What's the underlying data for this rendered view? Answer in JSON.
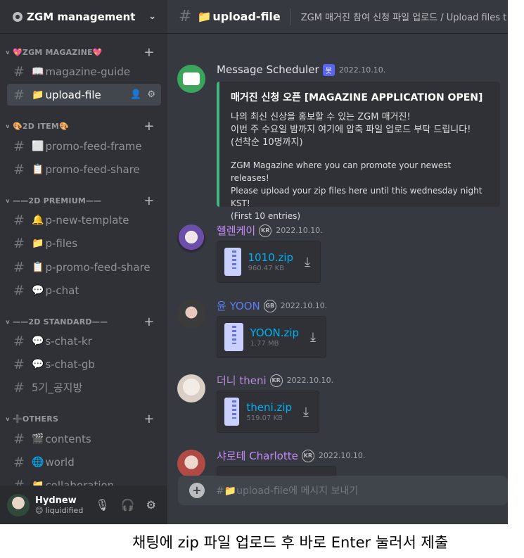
{
  "server": {
    "name": "ZGM management"
  },
  "sidebar": {
    "categories": [
      {
        "label": "💖ZGM MAGAZINE💖"
      },
      {
        "label": "🎨2D ITEM🎨"
      },
      {
        "label": "——2D PREMIUM——"
      },
      {
        "label": "——2D STANDARD——"
      },
      {
        "label": "➕OTHERS"
      }
    ],
    "channels": [
      {
        "emoji": "📖",
        "label": "magazine-guide"
      },
      {
        "emoji": "📁",
        "label": "upload-file"
      },
      {
        "emoji": "⬜",
        "label": "promo-feed-frame"
      },
      {
        "emoji": "📋",
        "label": "promo-feed-share"
      },
      {
        "emoji": "🔔",
        "label": "p-new-template"
      },
      {
        "emoji": "📁",
        "label": "p-files"
      },
      {
        "emoji": "📋",
        "label": "p-promo-feed-share"
      },
      {
        "emoji": "💬",
        "label": "p-chat"
      },
      {
        "emoji": "💬",
        "label": "s-chat-kr"
      },
      {
        "emoji": "💬",
        "label": "s-chat-gb"
      },
      {
        "emoji": "",
        "label": "5기_공지방"
      },
      {
        "emoji": "🎬",
        "label": "contents"
      },
      {
        "emoji": "🌐",
        "label": "world"
      },
      {
        "emoji": "📁",
        "label": "collaboration"
      }
    ]
  },
  "user": {
    "name": "Hydnew",
    "status": "liquidified"
  },
  "topbar": {
    "channel_emoji": "📁",
    "channel": "upload-file",
    "topic": "ZGM 매거진 참여 신청 파일 업로드 / Upload files t"
  },
  "messages": [
    {
      "author": "Message Scheduler",
      "badge": "봇",
      "timestamp": "2022.10.10.",
      "embed": {
        "title": "매거진 신청 오픈 [MAGAZINE APPLICATION OPEN]",
        "ko_lines": [
          "나의 최신 신상을 홍보할 수 있는 ZGM 매거진!",
          "이번 주 수요일 밤까지 여기에 압축 파일 업로드 부탁 드립니다!",
          "(선착순 10명까지)"
        ],
        "en_lines": [
          "ZGM Magazine where you can promote your newest releases!",
          "Please upload your zip files here until this wednesday night KST!",
          "(First 10 entries)"
        ]
      }
    },
    {
      "author": "헬렌케이",
      "flag": "KR",
      "timestamp": "2022.10.10.",
      "file": "1010.zip",
      "size": "960.47 KB"
    },
    {
      "author": "윤 YOON",
      "flag": "GB",
      "timestamp": "2022.10.10.",
      "file": "YOON.zip",
      "size": "1.77 MB"
    },
    {
      "author": "더니 theni",
      "flag": "KR",
      "timestamp": "2022.10.10.",
      "file": "theni.zip",
      "size": "519.07 KB"
    },
    {
      "author": "샤로테 Charlotte",
      "flag": "KR",
      "timestamp": "2022.10.10."
    }
  ],
  "composer": {
    "placeholder": "#📁upload-file에 메시지 보내기"
  },
  "caption": "채팅에 zip 파일 업로드 후 바로 Enter 눌러서 제출",
  "colors": {
    "accent_embed": "#43b581",
    "author_helen": "#c58af9",
    "author_yoon": "#5b7cf5",
    "author_theni": "#b88ad9",
    "author_charlotte": "#c58af9",
    "link": "#00b0f4",
    "bot_badge": "#5865f2"
  }
}
